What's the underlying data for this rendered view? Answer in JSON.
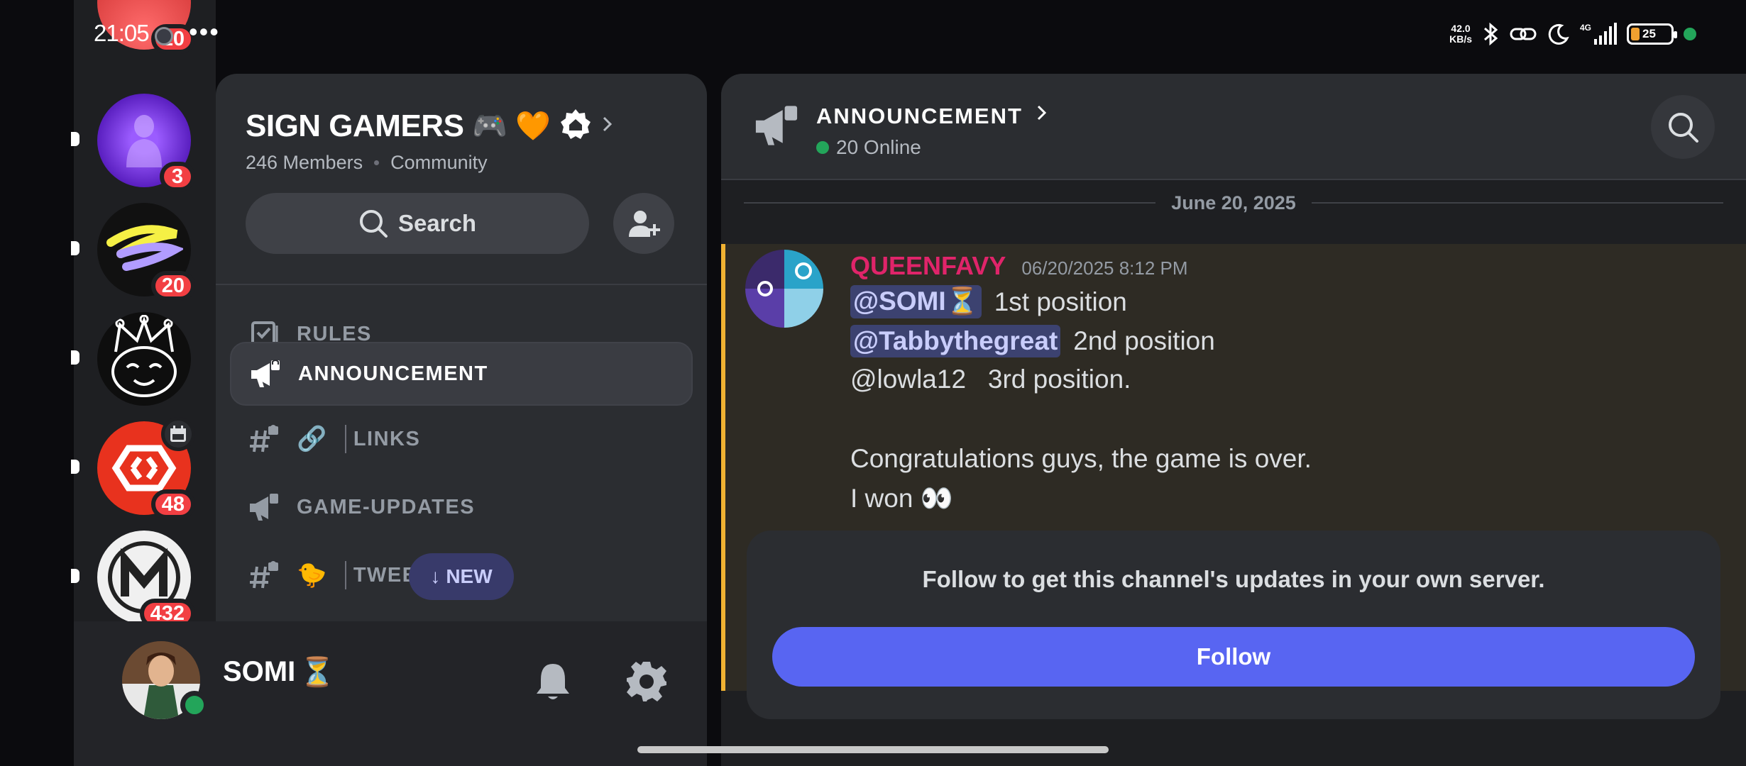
{
  "status_bar": {
    "time": "21:05",
    "more": "•••",
    "net_speed_value": "42.0",
    "net_speed_unit": "KB/s",
    "network": "4G",
    "battery": "25"
  },
  "servers": [
    {
      "name": "server-top",
      "badge": "10",
      "color": "#d94040"
    },
    {
      "name": "server-purple",
      "badge": "3",
      "color": "#6a2bd9"
    },
    {
      "name": "server-swirl",
      "badge": "20",
      "color": "#111111"
    },
    {
      "name": "server-cat",
      "badge": "",
      "color": "#111111"
    },
    {
      "name": "server-red-hex",
      "badge": "48",
      "color": "#e8321e"
    },
    {
      "name": "server-m",
      "badge": "432",
      "color": "#e8e8e8"
    }
  ],
  "sidebar": {
    "server_name": "SIGN GAMERS",
    "server_emojis": "🎮 🧡",
    "member_count": "246 Members",
    "community_label": "Community",
    "search_label": "Search",
    "channels": [
      {
        "label": "RULES",
        "icon": "rules-icon",
        "active": false
      },
      {
        "label": "ANNOUNCEMENT",
        "icon": "megaphone-icon",
        "active": true
      },
      {
        "label": "LINKS",
        "icon": "hash-lock-icon",
        "emoji": "🔗",
        "active": false
      },
      {
        "label": "GAME-UPDATES",
        "icon": "megaphone-icon",
        "active": false
      },
      {
        "label": "TWEET",
        "icon": "hash-lock-icon",
        "emoji": "🐤",
        "active": false
      }
    ],
    "new_pill_label": "NEW"
  },
  "user_bar": {
    "username": "SOMI",
    "username_emoji": "⏳"
  },
  "chat": {
    "channel_name": "ANNOUNCEMENT",
    "online_count": "20 Online",
    "date_divider": "June 20, 2025",
    "message": {
      "author": "QUEENFAVY",
      "timestamp": "06/20/2025 8:12 PM",
      "line1_mention": "@SOMI⏳",
      "line1_text": "1st position",
      "line2_mention": "@Tabbythegreat",
      "line2_text": "2nd position",
      "line3_text": "@lowla12   3rd position.",
      "line4_text": "Congratulations guys, the game is over.",
      "line5_text": "I won 👀"
    },
    "follow_text": "Follow to get this channel's updates in your own server.",
    "follow_button": "Follow"
  },
  "colors": {
    "accent": "#5865f2",
    "author": "#e0246a",
    "online": "#23a55a",
    "badge": "#f23f43",
    "highlight_bar": "#f0b232"
  }
}
